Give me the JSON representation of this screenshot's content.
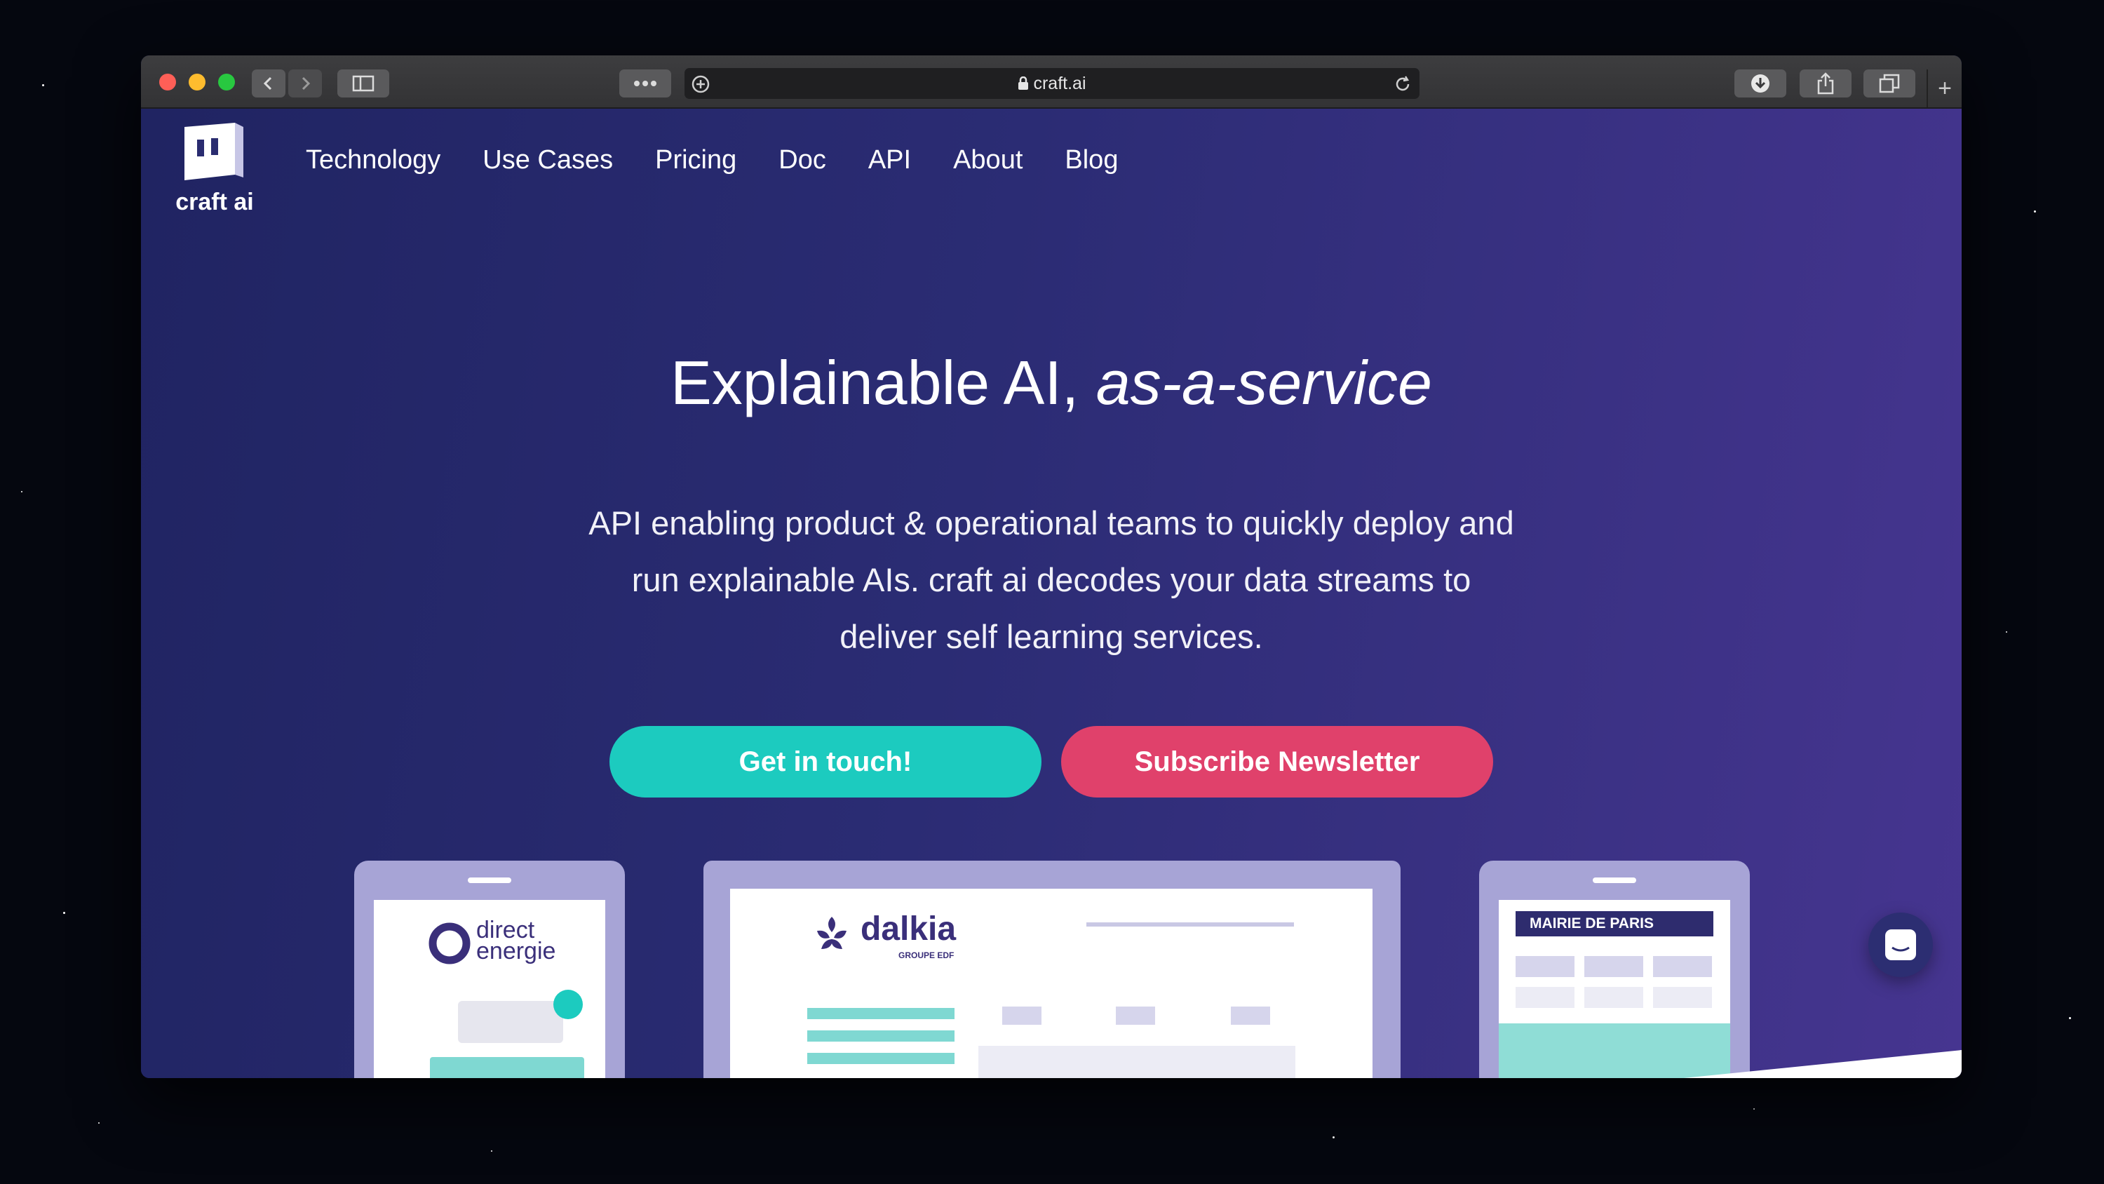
{
  "browser": {
    "url": "craft.ai",
    "colors": {
      "close": "#fe5f57",
      "minimize": "#febc2e",
      "zoom": "#28c840"
    }
  },
  "site": {
    "logo_text": "craft ai",
    "nav": [
      "Technology",
      "Use Cases",
      "Pricing",
      "Doc",
      "API",
      "About",
      "Blog"
    ]
  },
  "hero": {
    "title_main": "Explainable AI, ",
    "title_em": "as-a-service",
    "subtitle_lines": [
      "API enabling product & operational teams to quickly deploy and",
      "run explainable AIs. craft ai decodes your data streams to",
      "deliver self learning services."
    ],
    "cta_primary": "Get in touch!",
    "cta_secondary": "Subscribe Newsletter"
  },
  "showcase": {
    "direct_energie": {
      "line1": "direct",
      "line2": "energie"
    },
    "dalkia": {
      "name": "dalkia",
      "tagline": "GROUPE EDF"
    },
    "mairie": {
      "name": "MAIRIE DE PARIS"
    }
  },
  "colors": {
    "teal": "#1ccbbf",
    "pink": "#e0416b",
    "brand_purple": "#3a2f7a",
    "device": "#a7a4d6"
  }
}
